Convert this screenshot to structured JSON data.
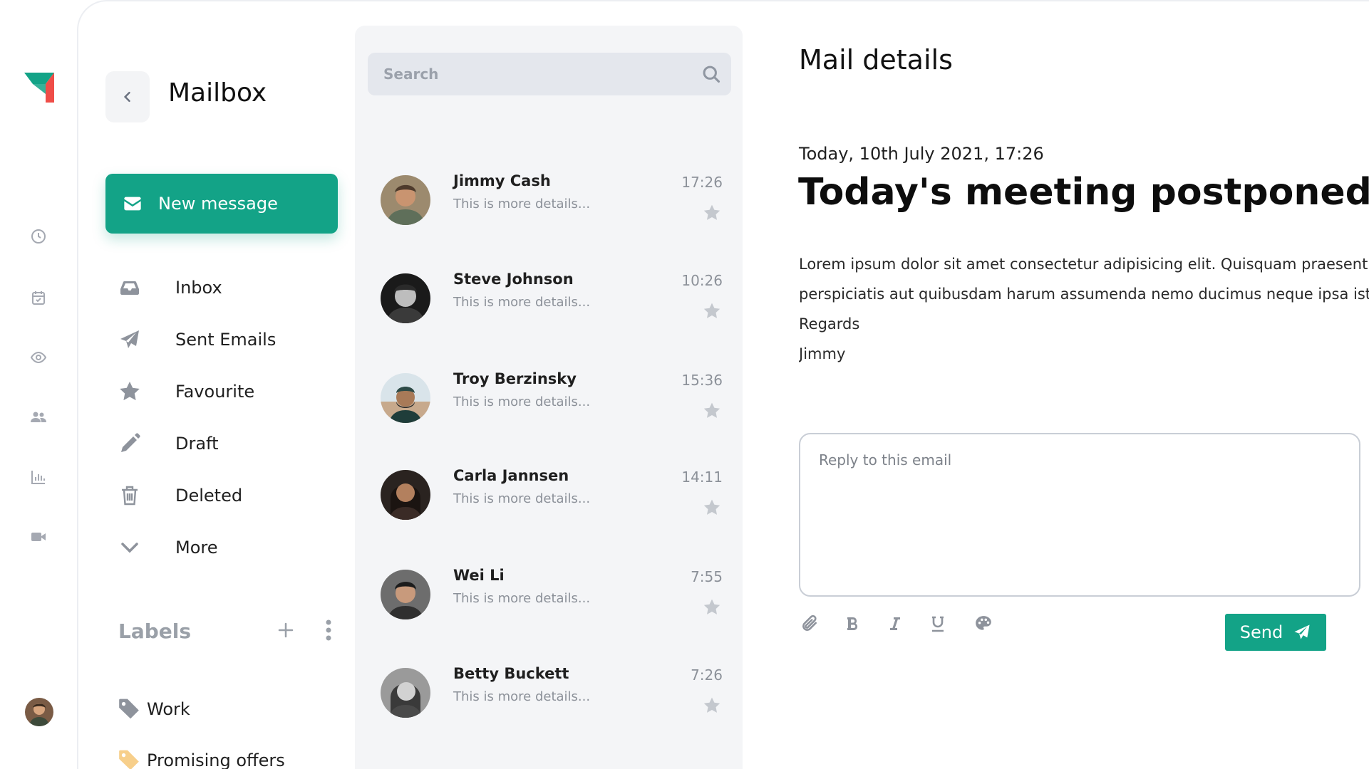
{
  "colors": {
    "accent": "#13a387",
    "logo_teal": "#13a387",
    "logo_red": "#ef4d48",
    "rail_icon": "#a5a9b2",
    "muted_text": "#8c9199"
  },
  "rail": {
    "icons": [
      "clock-icon",
      "calendar-check-icon",
      "eye-icon",
      "users-icon",
      "bar-chart-icon",
      "video-camera-icon"
    ]
  },
  "sidebar": {
    "title": "Mailbox",
    "new_message_label": "New message",
    "items": [
      {
        "label": "Inbox",
        "icon": "inbox-icon"
      },
      {
        "label": "Sent Emails",
        "icon": "paper-plane-icon"
      },
      {
        "label": "Favourite",
        "icon": "star-icon"
      },
      {
        "label": "Draft",
        "icon": "pencil-icon"
      },
      {
        "label": "Deleted",
        "icon": "trash-icon"
      },
      {
        "label": "More",
        "icon": "chevron-down-icon"
      }
    ],
    "labels_heading": "Labels",
    "labels": [
      {
        "label": "Work",
        "icon": "tag-icon",
        "color": "#8e939c"
      },
      {
        "label": "Promising offers",
        "icon": "tag-icon",
        "color": "#f7cf8b"
      }
    ]
  },
  "search": {
    "placeholder": "Search"
  },
  "mails": [
    {
      "sender": "Jimmy Cash",
      "preview": "This is more details...",
      "time": "17:26"
    },
    {
      "sender": "Steve Johnson",
      "preview": "This is more details...",
      "time": "10:26"
    },
    {
      "sender": "Troy Berzinsky",
      "preview": "This is more details...",
      "time": "15:36"
    },
    {
      "sender": "Carla Jannsen",
      "preview": "This is more details...",
      "time": "14:11"
    },
    {
      "sender": "Wei Li",
      "preview": "This is more details...",
      "time": "7:55"
    },
    {
      "sender": "Betty Buckett",
      "preview": "This is more details...",
      "time": "7:26"
    }
  ],
  "detail": {
    "heading": "Mail details",
    "date": "Today, 10th July 2021, 17:26",
    "subject": "Today's meeting postponed",
    "body_lines": [
      "Lorem ipsum dolor sit amet consectetur adipisicing elit. Quisquam praesentium",
      "perspiciatis aut quibusdam harum assumenda nemo ducimus neque ipsa iste",
      "Regards",
      "Jimmy"
    ],
    "reply_placeholder": "Reply to this email",
    "format_tools": [
      "paperclip-icon",
      "bold-icon",
      "italic-icon",
      "underline-icon",
      "palette-icon"
    ],
    "send_label": "Send"
  }
}
